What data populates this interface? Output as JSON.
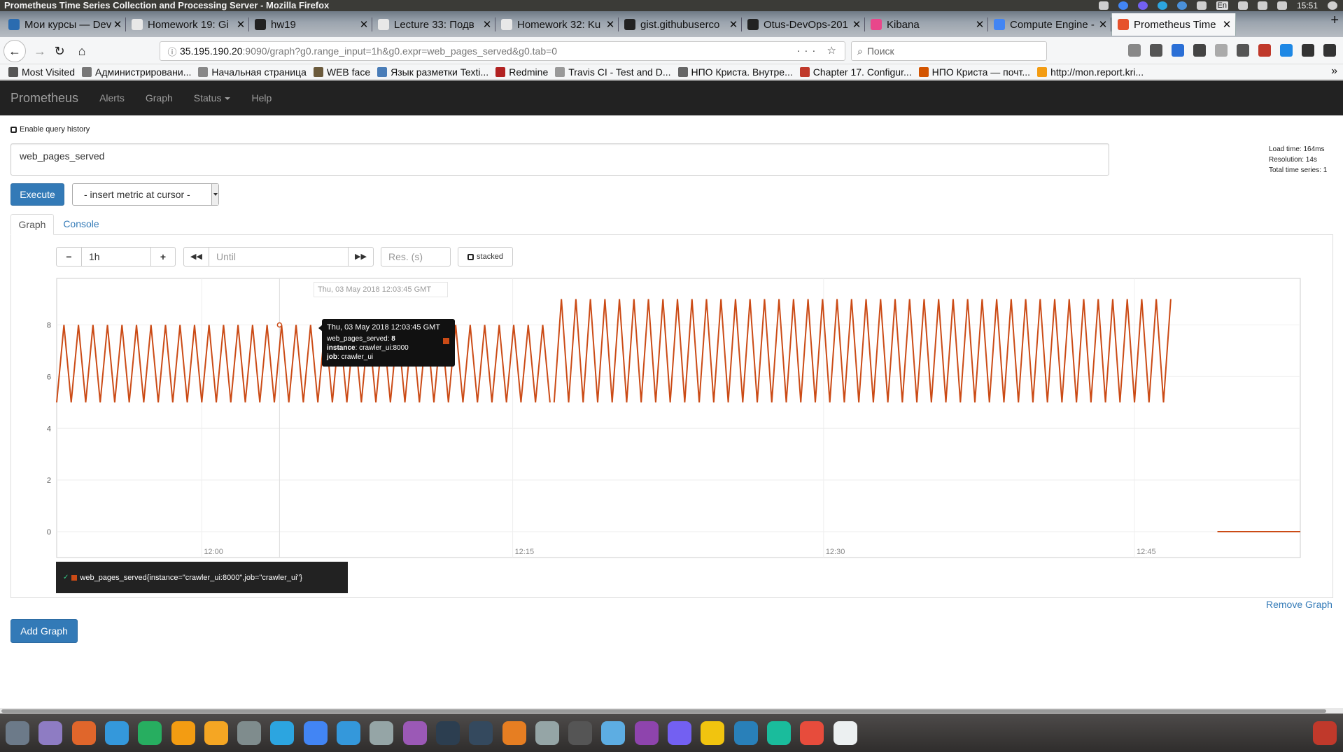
{
  "window": {
    "title": "Prometheus Time Series Collection and Processing Server - Mozilla Firefox",
    "clock": "15:51",
    "lang": "En"
  },
  "tabs": [
    {
      "label": "Мои курсы — Dev",
      "color": "#2b6cb0"
    },
    {
      "label": "Homework 19: Gi",
      "color": "#e8e8e8"
    },
    {
      "label": "hw19",
      "color": "#222222"
    },
    {
      "label": "Lecture 33: Подв",
      "color": "#e8e8e8"
    },
    {
      "label": "Homework 32: Ku",
      "color": "#e8e8e8"
    },
    {
      "label": "gist.githubuserco",
      "color": "#222222"
    },
    {
      "label": "Otus-DevOps-201",
      "color": "#222222"
    },
    {
      "label": "Kibana",
      "color": "#e8478b"
    },
    {
      "label": "Compute Engine -",
      "color": "#4285f4"
    },
    {
      "label": "Prometheus Time",
      "color": "#e6522c"
    }
  ],
  "navbar": {
    "url_host": "35.195.190.20",
    "url_rest": ":9090/graph?g0.range_input=1h&g0.expr=web_pages_served&g0.tab=0",
    "search_placeholder": "Поиск",
    "url_right_icons": "··· ☆"
  },
  "bookmarks": [
    {
      "label": "Most Visited",
      "color": "#555555"
    },
    {
      "label": "Администрировани...",
      "color": "#777777"
    },
    {
      "label": "Начальная страница",
      "color": "#888888"
    },
    {
      "label": "WEB face",
      "color": "#6b5a3c"
    },
    {
      "label": "Язык разметки Texti...",
      "color": "#4a7db8"
    },
    {
      "label": "Redmine",
      "color": "#b22222"
    },
    {
      "label": "Travis CI - Test and D...",
      "color": "#999999"
    },
    {
      "label": "НПО Криста. Внутре...",
      "color": "#666666"
    },
    {
      "label": "Chapter 17. Configur...",
      "color": "#c0392b"
    },
    {
      "label": "НПО Криста — почт...",
      "color": "#d35400"
    },
    {
      "label": "http://mon.report.kri...",
      "color": "#f39c12"
    }
  ],
  "prometheus": {
    "brand": "Prometheus",
    "nav": [
      "Alerts",
      "Graph",
      "Status",
      "Help"
    ],
    "enable_history": "Enable query history",
    "expression": "web_pages_served",
    "stats": {
      "load_time": "Load time: 164ms",
      "resolution": "Resolution: 14s",
      "total_series": "Total time series: 1"
    },
    "execute_label": "Execute",
    "metric_select": "- insert metric at cursor -",
    "tab_graph": "Graph",
    "tab_console": "Console",
    "range": "1h",
    "until_placeholder": "Until",
    "res_placeholder": "Res. (s)",
    "stacked": "stacked",
    "hover_time": "Thu, 03 May 2018 12:03:45 GMT",
    "tooltip": {
      "title": "Thu, 03 May 2018 12:03:45 GMT",
      "metric_key": "web_pages_served",
      "metric_value": "8",
      "instance_key": "instance",
      "instance_value": "crawler_ui:8000",
      "job_key": "job",
      "job_value": "crawler_ui"
    },
    "legend": "web_pages_served{instance=\"crawler_ui:8000\",job=\"crawler_ui\"}",
    "remove_graph": "Remove Graph",
    "add_graph": "Add Graph"
  },
  "chart_data": {
    "type": "line",
    "x_start": "11:53",
    "x_end": "12:53",
    "x_ticks": [
      "12:00",
      "12:15",
      "12:30",
      "12:45"
    ],
    "y_ticks": [
      "0",
      "2",
      "4",
      "6",
      "8"
    ],
    "ylim": [
      -1,
      9.8
    ],
    "grid": true,
    "color": "#cb4b16",
    "series": [
      {
        "segments": [
          {
            "from": "11:53",
            "to": "12:17",
            "pattern": "oscillates 5 to 8",
            "low": 5,
            "high": 8,
            "period_minutes": 0.7
          },
          {
            "from": "12:17",
            "to": "12:47",
            "pattern": "oscillates 5 to 9",
            "low": 5,
            "high": 9,
            "period_minutes": 0.7
          },
          {
            "from": "12:49",
            "to": "12:53",
            "pattern": "flat",
            "value": 0
          }
        ]
      }
    ]
  },
  "taskbar": [
    "#6c7a89",
    "#8e7cc3",
    "#e0662b",
    "#3498db",
    "#27ae60",
    "#f39c12",
    "#f5a623",
    "#7f8c8d",
    "#2ca5e0",
    "#4285f4",
    "#3498db",
    "#95a5a6",
    "#9b59b6",
    "#2c3e50",
    "#34495e",
    "#e67e22",
    "#95a5a6",
    "#555555",
    "#5dade2",
    "#8e44ad",
    "#7360f2",
    "#f1c40f",
    "#2980b9",
    "#1abc9c",
    "#e74c3c",
    "#ecf0f1"
  ]
}
